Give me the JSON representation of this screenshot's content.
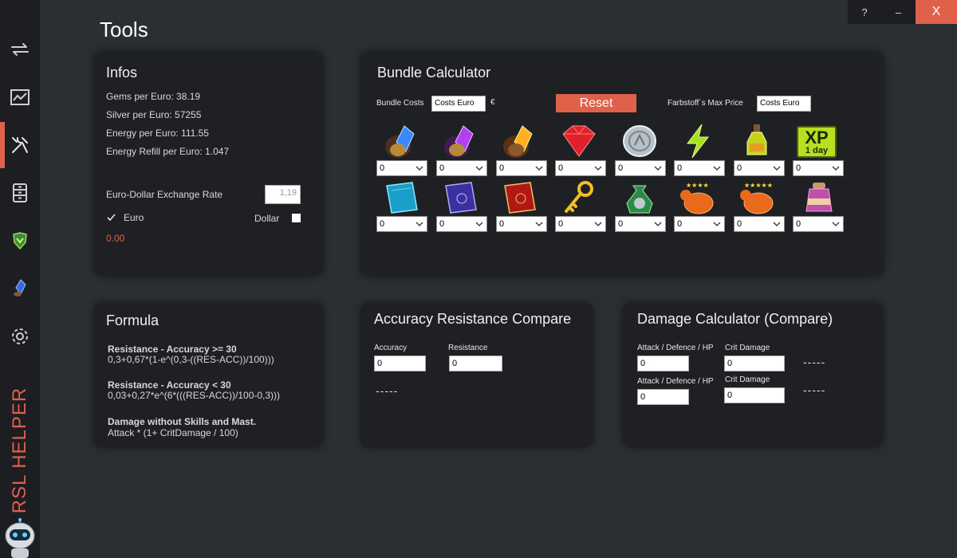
{
  "window": {
    "help_label": "?",
    "minimize_label": "–",
    "close_label": "X"
  },
  "brand": {
    "title": "RSL HELPER"
  },
  "page": {
    "title": "Tools"
  },
  "sidebar": {
    "items": [
      "sync-icon",
      "chart-icon",
      "tools-icon",
      "storage-icon",
      "shield-icon",
      "shard-icon",
      "gear-icon"
    ],
    "active": "tools-icon"
  },
  "infos": {
    "title": "Infos",
    "gems": "Gems per Euro: 38.19",
    "silver": "Silver per Euro: 57255",
    "energy": "Energy per Euro: 111.55",
    "refill": "Energy Refill per Euro: 1.047",
    "rate_label": "Euro-Dollar Exchange Rate",
    "rate_placeholder": "1,19",
    "euro_label": "Euro",
    "dollar_label": "Dollar",
    "euro_checked": true,
    "dollar_checked": false,
    "result": "0.00"
  },
  "bundle": {
    "title": "Bundle Calculator",
    "costs_label": "Bundle Costs",
    "costs_placeholder": "Costs Euro",
    "currency": "€",
    "reset_label": "Reset",
    "max_price_label": "Farbstoff´s Max Price",
    "max_price_placeholder": "Costs Euro",
    "xp_top": "XP",
    "xp_bottom": "1 day",
    "rows": [
      [
        {
          "icon": "ancient-shard-icon",
          "value": "0"
        },
        {
          "icon": "void-shard-icon",
          "value": "0"
        },
        {
          "icon": "sacred-shard-icon",
          "value": "0"
        },
        {
          "icon": "ruby-gem-icon",
          "value": "0"
        },
        {
          "icon": "silver-coin-icon",
          "value": "0"
        },
        {
          "icon": "energy-bolt-icon",
          "value": "0"
        },
        {
          "icon": "potion-bottle-icon",
          "value": "0"
        },
        {
          "icon": "xp-boost-icon",
          "value": "0"
        }
      ],
      [
        {
          "icon": "blue-tome-icon",
          "value": "0"
        },
        {
          "icon": "purple-tome-icon",
          "value": "0"
        },
        {
          "icon": "red-tome-icon",
          "value": "0"
        },
        {
          "icon": "gold-key-icon",
          "value": "0"
        },
        {
          "icon": "silver-bag-icon",
          "value": "0"
        },
        {
          "icon": "chicken-4star-icon",
          "value": "0"
        },
        {
          "icon": "chicken-5star-icon",
          "value": "0"
        },
        {
          "icon": "potion-flask-icon",
          "value": "0"
        }
      ]
    ]
  },
  "formula": {
    "title": "Formula",
    "f1_title": "Resistance - Accuracy >= 30",
    "f1_body": "0,3+0,67*(1-e^(0,3-((RES-ACC))/100)))",
    "f2_title": "Resistance - Accuracy < 30",
    "f2_body": "0,03+0,27*e^(6*(((RES-ACC))/100-0,3)))",
    "f3_title": "Damage without Skills and Mast.",
    "f3_body": "Attack * (1+ CritDamage / 100)"
  },
  "accuracy": {
    "title": "Accuracy Resistance Compare",
    "acc_label": "Accuracy",
    "acc_value": "0",
    "res_label": "Resistance",
    "res_value": "0",
    "result": "-----"
  },
  "damage": {
    "title": "Damage Calculator (Compare)",
    "atk_label_1": "Attack / Defence / HP",
    "atk_value_1": "0",
    "crit_label_1": "Crit Damage",
    "crit_value_1": "0",
    "result_1": "-----",
    "atk_label_2": "Attack / Defence / HP",
    "atk_value_2": "0",
    "crit_label_2": "Crit Damage",
    "crit_value_2": "0",
    "result_2": "-----"
  },
  "colors": {
    "accent": "#e0614a",
    "background": "#2b2f33",
    "card": "#1e2023",
    "sidebar": "#1c1e21",
    "close_button": "#e0614a"
  }
}
